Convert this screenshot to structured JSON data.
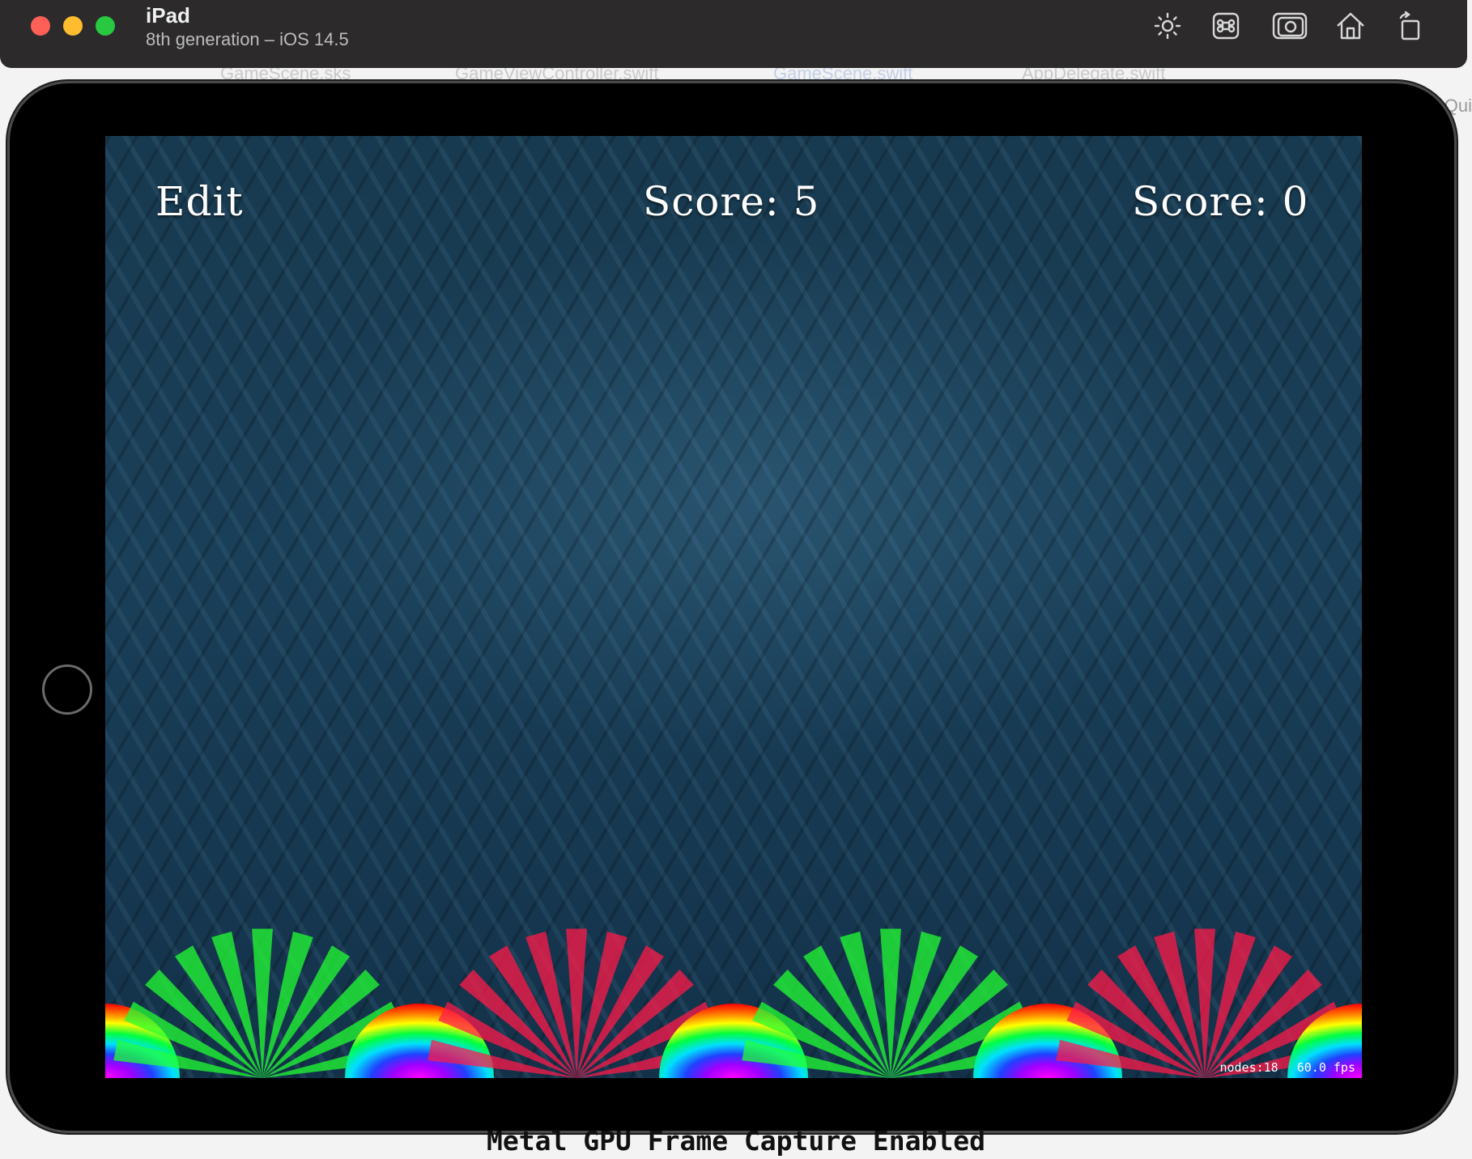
{
  "simulator": {
    "device_name": "iPad",
    "device_detail": "8th generation – iOS 14.5",
    "toolbar_icons": [
      "brightness-icon",
      "command-key-icon",
      "screenshot-camera-icon",
      "home-icon",
      "rotate-icon"
    ]
  },
  "xcode": {
    "tabs": [
      "GameScene.sks",
      "GameViewController.swift",
      "GameScene.swift",
      "AppDelegate.swift"
    ],
    "active_tab_index": 2,
    "right_edge_text": "Qui",
    "gpu_banner": "Metal GPU Frame Capture Enabled"
  },
  "game": {
    "edit_label": "Edit",
    "score_left": "Score: 5",
    "score_right": "Score: 0",
    "stats_nodes": "nodes:18",
    "stats_fps": "60.0 fps",
    "effects": [
      {
        "kind": "rainbow",
        "color": "#ff0000"
      },
      {
        "kind": "starburst",
        "color": "#22ff33"
      },
      {
        "kind": "rainbow",
        "color": "#ff0000"
      },
      {
        "kind": "starburst",
        "color": "#ff1a4a"
      },
      {
        "kind": "rainbow",
        "color": "#ff0000"
      },
      {
        "kind": "starburst",
        "color": "#22ff33"
      },
      {
        "kind": "rainbow",
        "color": "#ff0000"
      },
      {
        "kind": "starburst",
        "color": "#ff1a4a"
      },
      {
        "kind": "rainbow",
        "color": "#ff0000"
      }
    ]
  }
}
